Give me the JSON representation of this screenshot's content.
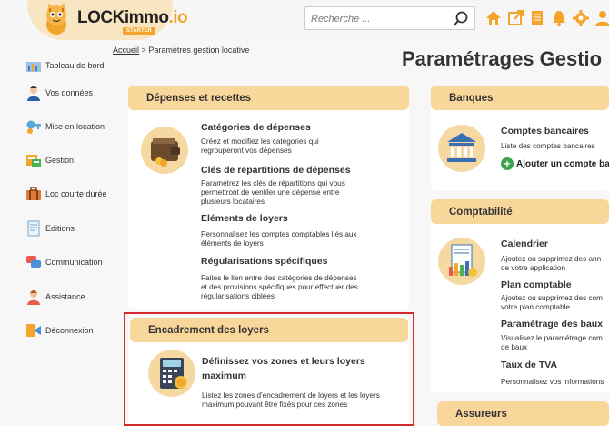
{
  "header": {
    "logo_text": "LOCKimmo",
    "logo_suffix": ".io",
    "logo_badge": "STARTER",
    "search_placeholder": "Recherche ..."
  },
  "sidebar": {
    "items": [
      {
        "label": "Tableau de bord",
        "icon": "dashboard-icon"
      },
      {
        "label": "Vos données",
        "icon": "user-icon"
      },
      {
        "label": "Mise en location",
        "icon": "key-icon"
      },
      {
        "label": "Gestion",
        "icon": "gestion-icon"
      },
      {
        "label": "Loc courte durée",
        "icon": "suitcase-icon"
      },
      {
        "label": "Editions",
        "icon": "document-icon"
      },
      {
        "label": "Communication",
        "icon": "chat-icon"
      },
      {
        "label": "Assistance",
        "icon": "support-icon"
      },
      {
        "label": "Déconnexion",
        "icon": "logout-icon"
      }
    ]
  },
  "breadcrumb": {
    "home": "Accueil",
    "separator": ">",
    "current": "Paramètres gestion locative"
  },
  "page_title": "Paramétrages Gestio",
  "depenses": {
    "header": "Dépenses et recettes",
    "sections": [
      {
        "title": "Catégories de dépenses",
        "desc": "Créez et modifiez les catégories qui regrouperont vos dépenses"
      },
      {
        "title": "Clés de répartitions de dépenses",
        "desc": "Paramétrez les clés de répartitions qui vous permettront de ventiler une dépense entre plusieurs locataires"
      },
      {
        "title": "Eléments de loyers",
        "desc": "Personnalisez les comptes comptables liés aux éléments de loyers"
      },
      {
        "title": "Régularisations spécifiques",
        "desc": "Faites le lien entre des catégories de dépenses et des provisions spécifiques pour effectuer des régularisations ciblées"
      }
    ]
  },
  "encadrement": {
    "header": "Encadrement des loyers",
    "title": "Définissez vos zones et leurs loyers maximum",
    "desc": "Listez les zones d'encadrement de loyers et les loyers maximum pouvant être fixés pour ces zones"
  },
  "banques": {
    "header": "Banques",
    "title": "Comptes bancaires",
    "desc": "Liste des comptes bancaires",
    "add_label": "Ajouter un compte ba"
  },
  "comptabilite": {
    "header": "Comptabilité",
    "sections": [
      {
        "title": "Calendrier",
        "desc": "Ajoutez ou supprimez des ann de votre application"
      },
      {
        "title": "Plan comptable",
        "desc": "Ajoutez ou supprimez des com votre plan comptable"
      },
      {
        "title": "Paramétrage des baux",
        "desc": "Visualisez le paramétrage com de baux"
      },
      {
        "title": "Taux de TVA",
        "desc": "Personnalisez vos informations"
      }
    ]
  },
  "assureurs": {
    "header": "Assureurs"
  },
  "colors": {
    "accent": "#f2a52a",
    "card_header": "#f9d79a",
    "highlight_border": "#d52a2a",
    "add_green": "#3ca34f"
  }
}
